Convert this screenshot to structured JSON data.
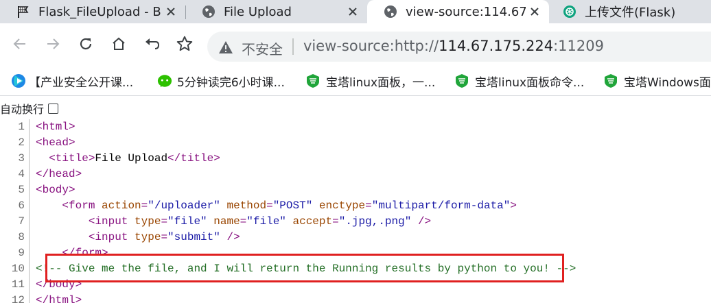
{
  "tabs": [
    {
      "title": "Flask_FileUpload - B",
      "favicon": "flag-icon",
      "active": false
    },
    {
      "title": "File Upload",
      "favicon": "globe-icon",
      "active": false
    },
    {
      "title": "view-source:114.67.",
      "favicon": "globe-icon",
      "active": true
    },
    {
      "title": "上传文件(Flask)",
      "favicon": "openai-icon",
      "active": false
    }
  ],
  "toolbar": {
    "insecure_label": "不安全",
    "url_scheme": "view-source:http://",
    "url_host": "114.67.175.224",
    "url_port": ":11209"
  },
  "bookmarks": [
    {
      "label": "【产业安全公开课...",
      "icon": "video-play-icon"
    },
    {
      "label": "5分钟读完6小时课...",
      "icon": "wechat-icon"
    },
    {
      "label": "宝塔linux面板，一...",
      "icon": "baota-icon"
    },
    {
      "label": "宝塔linux面板命令...",
      "icon": "baota-icon"
    },
    {
      "label": "宝塔Windows面",
      "icon": "baota-icon"
    }
  ],
  "wrap": {
    "label": "自动换行",
    "checked": false
  },
  "source": {
    "line_numbers": [
      "1",
      "2",
      "3",
      "4",
      "5",
      "6",
      "7",
      "8",
      "9",
      "10",
      "11",
      "12"
    ],
    "l1": {
      "t": "<html>"
    },
    "l2": {
      "t": "<head>"
    },
    "l3": {
      "indent": "  ",
      "open": "<title>",
      "text": "File Upload",
      "close": "</title>"
    },
    "l4": {
      "t": "</head>"
    },
    "l5": {
      "t": "<body>"
    },
    "l6": {
      "indent": "    ",
      "tag_open": "<form",
      "a1": "action",
      "v1": "\"/uploader\"",
      "a2": "method",
      "v2": "\"POST\"",
      "a3": "enctype",
      "v3": "\"multipart/form-data\"",
      "tag_end": ">"
    },
    "l7": {
      "indent": "        ",
      "tag_open": "<input",
      "a1": "type",
      "v1": "\"file\"",
      "a2": "name",
      "v2": "\"file\"",
      "a3": "accept",
      "v3": "\".jpg,.png\"",
      "tag_end": "/>"
    },
    "l8": {
      "indent": "        ",
      "tag_open": "<input",
      "a1": "type",
      "v1": "\"submit\"",
      "tag_end": "/>"
    },
    "l9": {
      "indent": "    ",
      "t": "</form>"
    },
    "l10": {
      "comment": "<!-- Give me the file, and I will return the Running results by python to you! -->"
    },
    "l11": {
      "t": "</body>"
    },
    "l12": {
      "t": "</html>"
    }
  },
  "colors": {
    "highlight": "#e02020",
    "tag": "#881280",
    "attr_name": "#994500",
    "attr_value": "#1a1aa6",
    "comment": "#236e25"
  }
}
